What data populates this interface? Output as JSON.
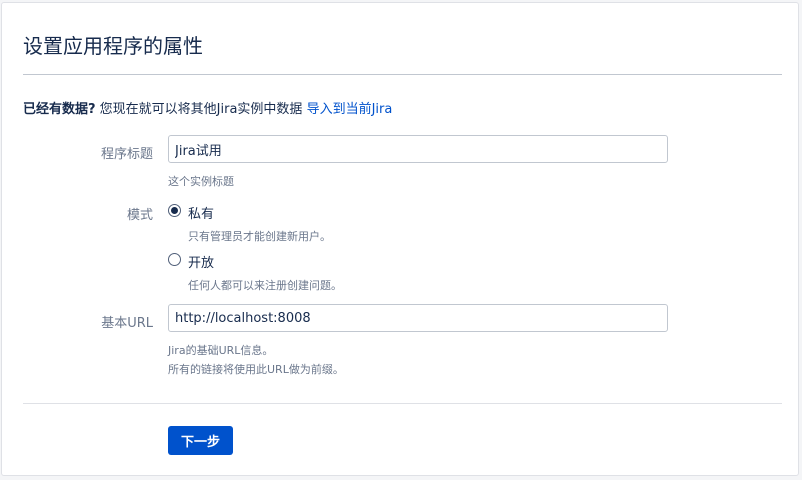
{
  "page": {
    "title": "设置应用程序的属性"
  },
  "import": {
    "strong_text": "已经有数据?",
    "text": " 您现在就可以将其他Jira实例中数据 ",
    "link_text": "导入到当前Jira"
  },
  "form": {
    "app_title": {
      "label": "程序标题",
      "value": "Jira试用",
      "hint": "这个实例标题"
    },
    "mode": {
      "label": "模式",
      "options": [
        {
          "label": "私有",
          "description": "只有管理员才能创建新用户。",
          "checked": true
        },
        {
          "label": "开放",
          "description": "任何人都可以来注册创建问题。",
          "checked": false
        }
      ]
    },
    "base_url": {
      "label": "基本URL",
      "value": "http://localhost:8008",
      "hint_line1": "Jira的基础URL信息。",
      "hint_line2": "所有的链接将使用此URL做为前缀。"
    }
  },
  "actions": {
    "next_label": "下一步"
  },
  "colors": {
    "primary": "#0052cc",
    "text": "#172b4d",
    "muted": "#6b778c"
  }
}
